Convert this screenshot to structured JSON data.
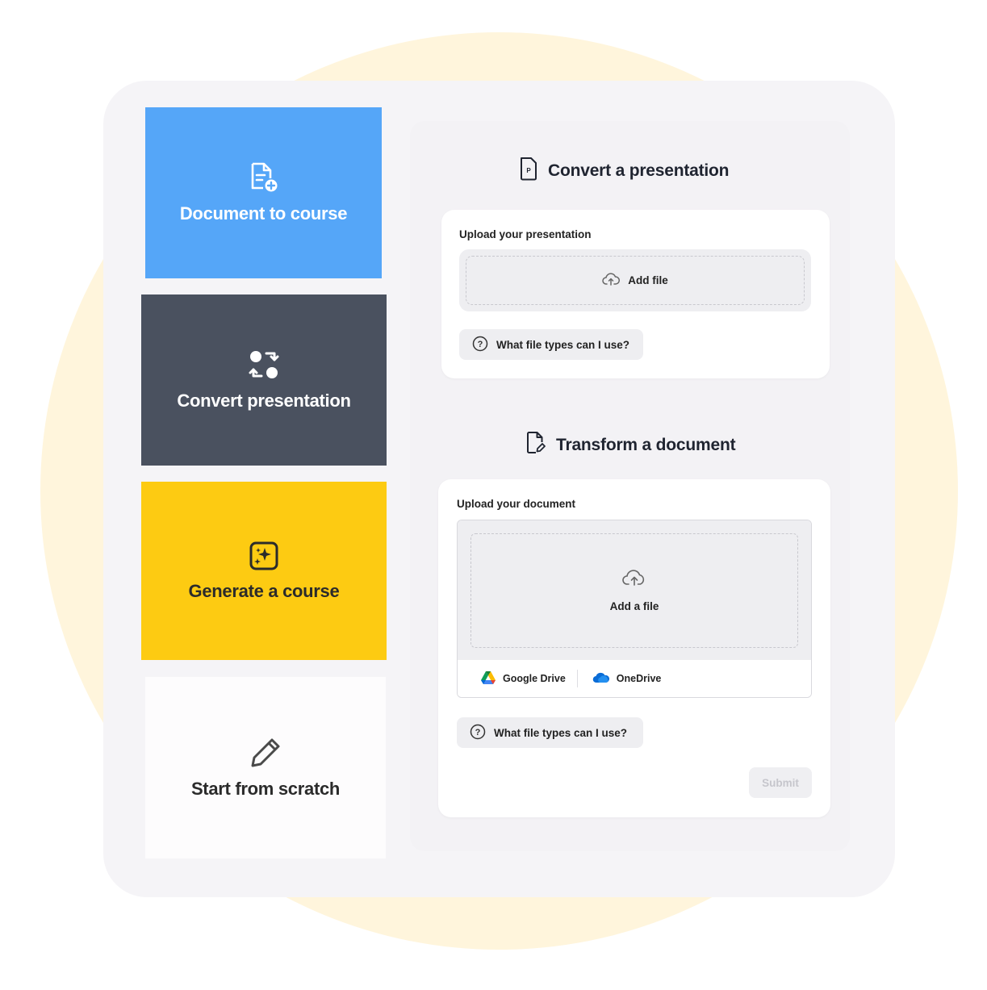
{
  "tiles": {
    "document_to_course": "Document to course",
    "convert_presentation": "Convert presentation",
    "generate_course": "Generate a course",
    "start_from_scratch": "Start from scratch"
  },
  "presentation_section": {
    "title": "Convert a presentation",
    "upload_label": "Upload your presentation",
    "add_file": "Add file",
    "help": "What file types can I use?"
  },
  "document_section": {
    "title": "Transform a document",
    "upload_label": "Upload your document",
    "add_file": "Add a file",
    "sources": [
      "Google Drive",
      "OneDrive"
    ],
    "help": "What file types can I use?",
    "submit": "Submit"
  },
  "colors": {
    "doc_tile": "#55a6f8",
    "convert_tile": "#4a515f",
    "generate_tile": "#fdcb12",
    "scratch_tile": "#fdfcfd",
    "backdrop_circle": "#fff5dc"
  },
  "icons": {
    "doc_tile": "document-add-icon",
    "convert_tile": "convert-arrows-icon",
    "generate_tile": "sparkle-icon",
    "scratch_tile": "pencil-icon",
    "presentation": "presentation-file-icon",
    "document": "document-edit-icon",
    "upload": "cloud-upload-icon",
    "help": "question-circle-icon",
    "google_drive": "google-drive-icon",
    "onedrive": "onedrive-icon"
  }
}
